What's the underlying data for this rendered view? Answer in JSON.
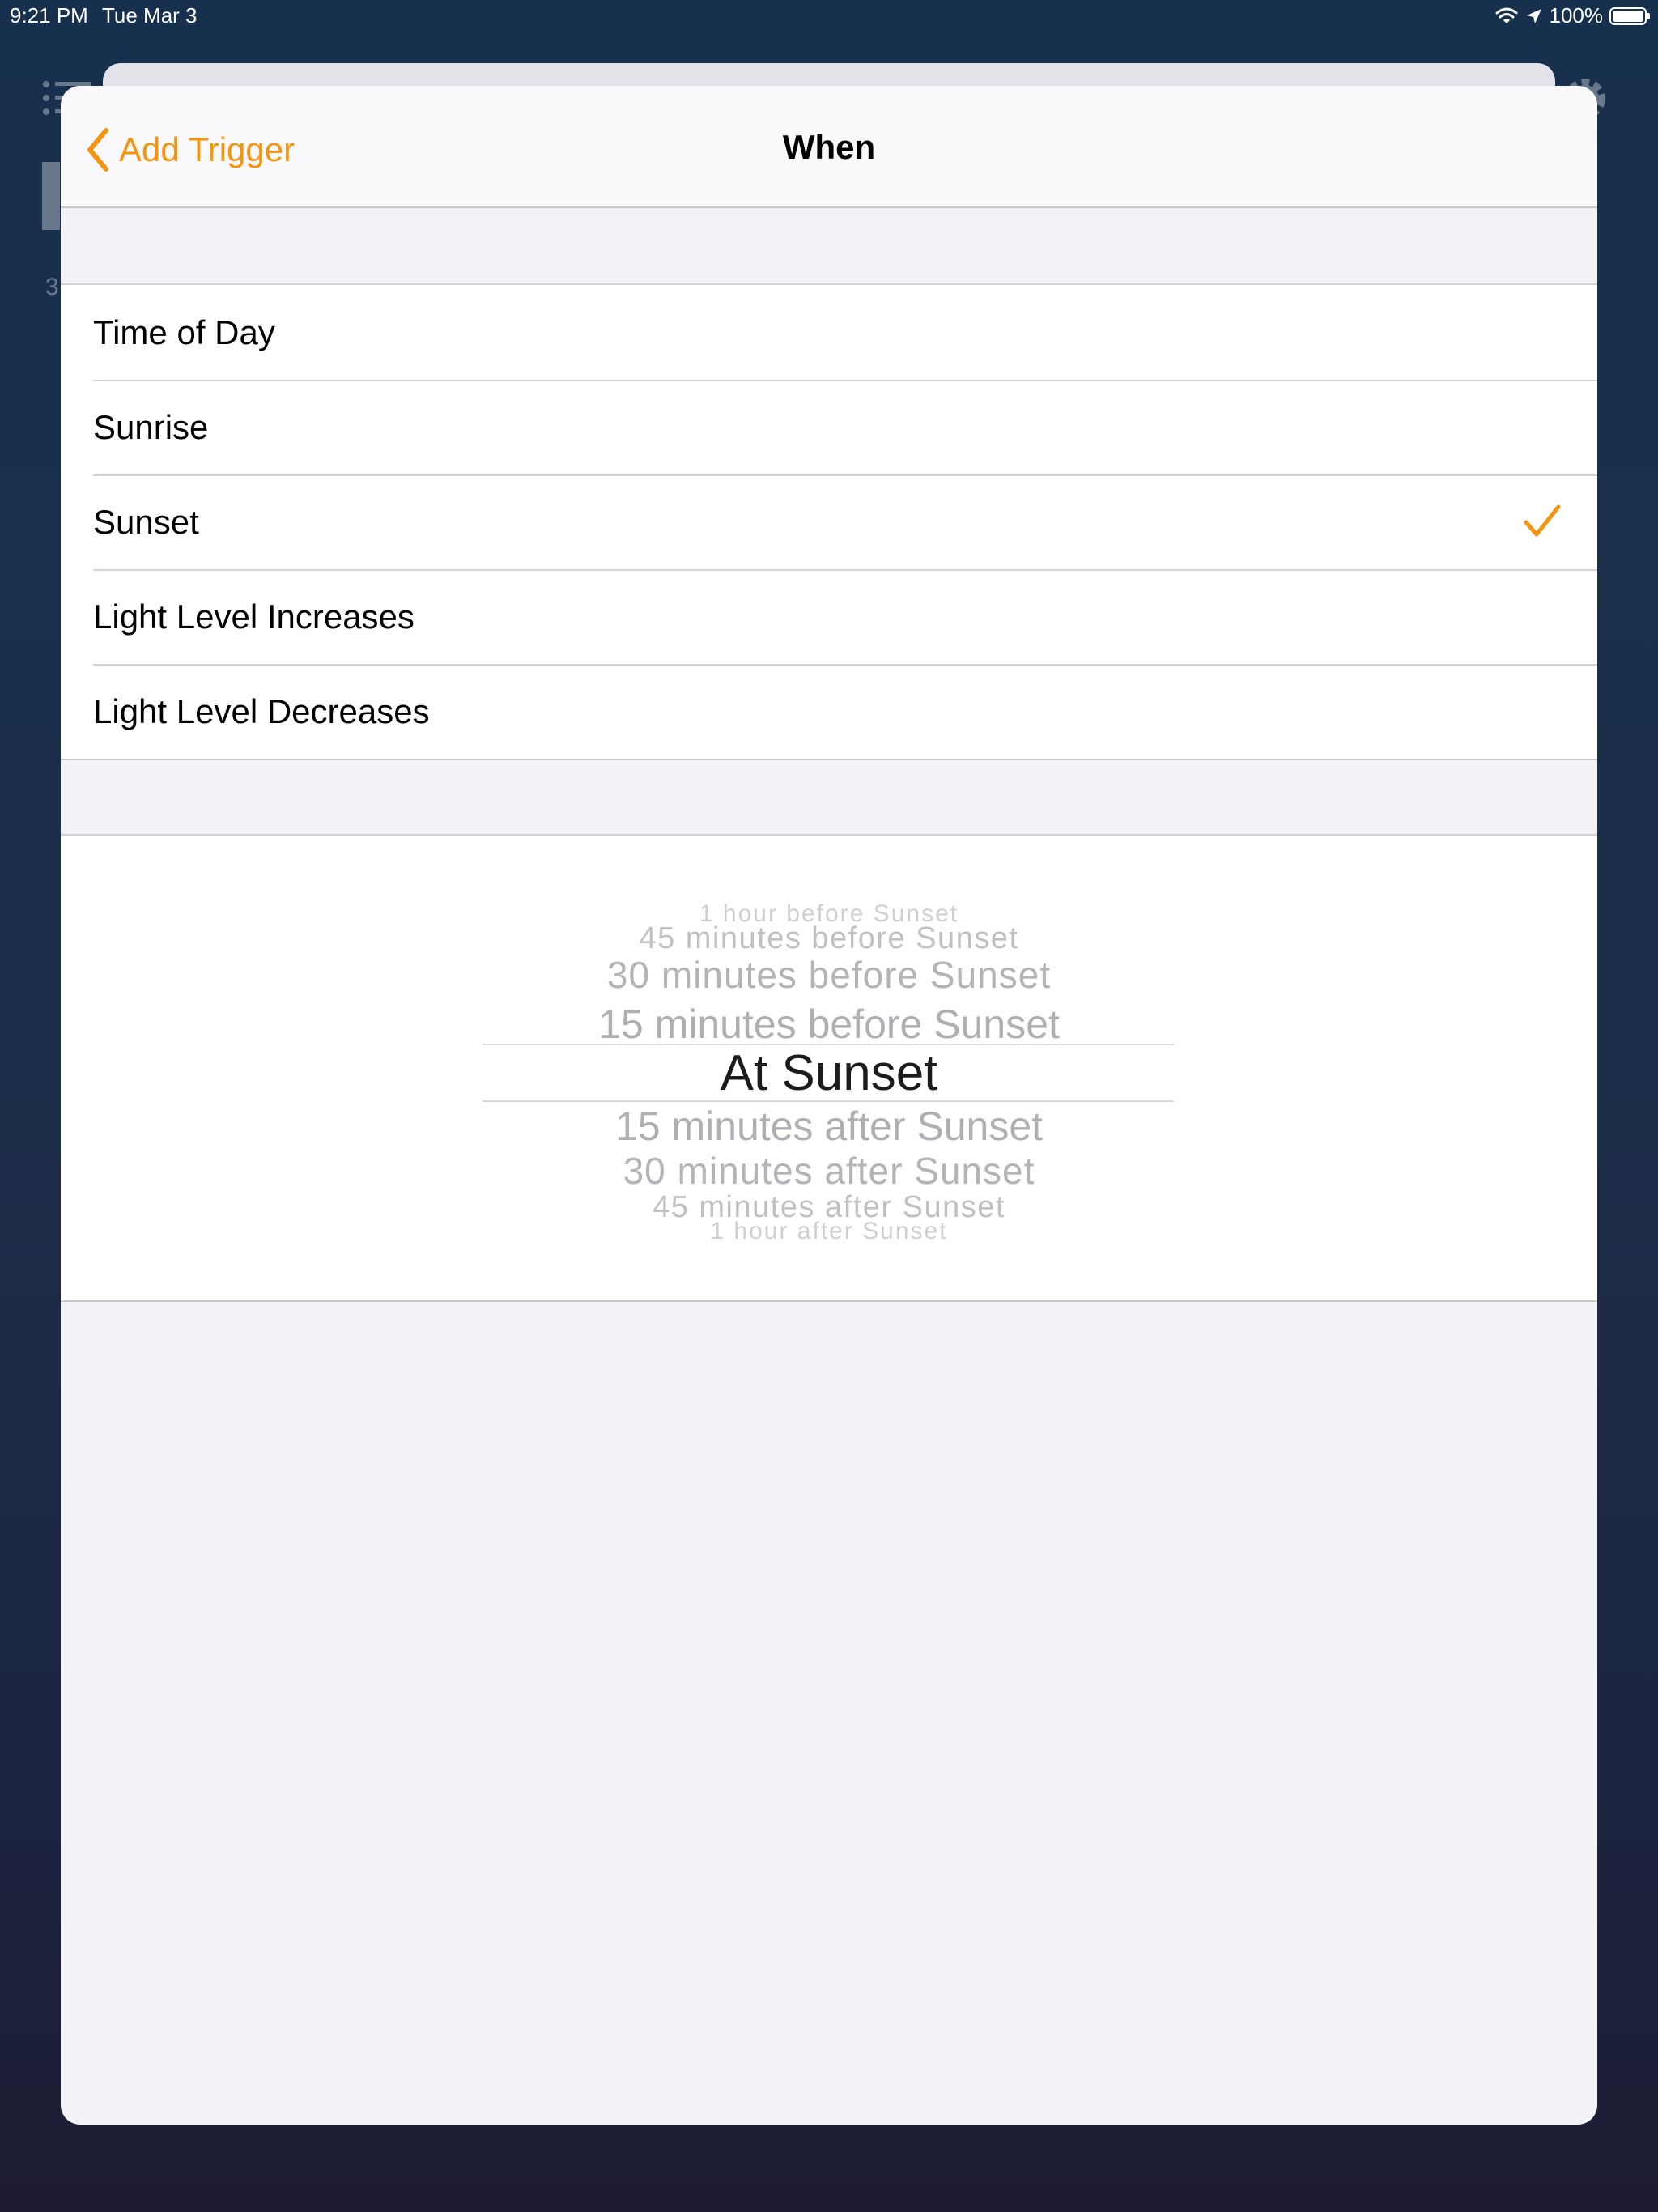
{
  "status_bar": {
    "time": "9:21 PM",
    "date": "Tue Mar 3",
    "battery": "100%",
    "icons": [
      "wifi-icon",
      "location-icon",
      "battery-icon"
    ]
  },
  "background": {
    "subtitle_peek": "3"
  },
  "nav": {
    "back_label": "Add Trigger",
    "title": "When"
  },
  "options": [
    {
      "label": "Time of Day",
      "selected": false
    },
    {
      "label": "Sunrise",
      "selected": false
    },
    {
      "label": "Sunset",
      "selected": true
    },
    {
      "label": "Light Level Increases",
      "selected": false
    },
    {
      "label": "Light Level Decreases",
      "selected": false
    }
  ],
  "picker": {
    "items": [
      "1 hour before Sunset",
      "45 minutes before Sunset",
      "30 minutes before Sunset",
      "15 minutes before Sunset",
      "At Sunset",
      "15 minutes after Sunset",
      "30 minutes after Sunset",
      "45 minutes after Sunset",
      "1 hour after Sunset"
    ],
    "selected_index": 4
  },
  "colors": {
    "accent": "#f5940f",
    "sheet_background": "#f2f2f7",
    "row_background": "#ffffff"
  }
}
